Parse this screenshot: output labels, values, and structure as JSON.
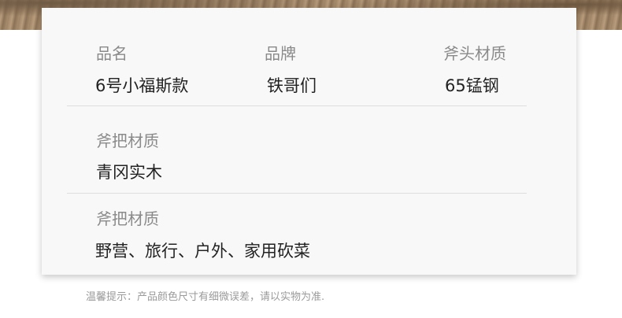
{
  "spec_card": {
    "row1": {
      "col1": {
        "label": "品名",
        "value": "6号小福斯款"
      },
      "col2": {
        "label": "品牌",
        "value": "铁哥们"
      },
      "col3": {
        "label": "斧头材质",
        "value": "65锰钢"
      }
    },
    "row2": {
      "label": "斧把材质",
      "value": "青冈实木"
    },
    "row3": {
      "label": "斧把材质",
      "value": "野营、旅行、户外、家用砍菜"
    }
  },
  "footer_note": "温馨提示：产品颜色尺寸有细微误差，请以实物为准."
}
